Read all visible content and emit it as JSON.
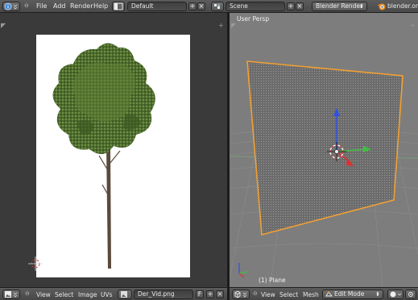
{
  "topbar": {
    "menus": [
      "File",
      "Add",
      "Render",
      "Help"
    ],
    "layout_name": "Default",
    "scene_name": "Scene",
    "render_engine": "Blender Render",
    "website": "blender.org",
    "add_symbol": "+",
    "close_symbol": "×",
    "dropdown_arrow": "⬍"
  },
  "image_editor": {
    "menus": [
      "View",
      "Select",
      "Image",
      "UVs"
    ],
    "image_name": "Der_Vid.png",
    "fake_user": "F"
  },
  "viewport": {
    "title": "User Persp",
    "object_label": "(1) Plane",
    "menus": [
      "View",
      "Select",
      "Mesh"
    ],
    "mode": "Edit Mode"
  },
  "colors": {
    "header": "#4e4e4e",
    "viewport_bg": "#7d7d7d",
    "selection_outline": "#f2a033",
    "axis_x": "#e03030",
    "axis_y": "#40c040",
    "axis_z": "#3050e0"
  },
  "icons": {
    "editor_type": "info-icon",
    "screen_layout": "screen-layout-icon",
    "scene": "scene-icon",
    "blender_logo": "blender-logo-icon",
    "image_editor_type": "image-editor-icon",
    "view3d_type": "view3d-icon"
  }
}
